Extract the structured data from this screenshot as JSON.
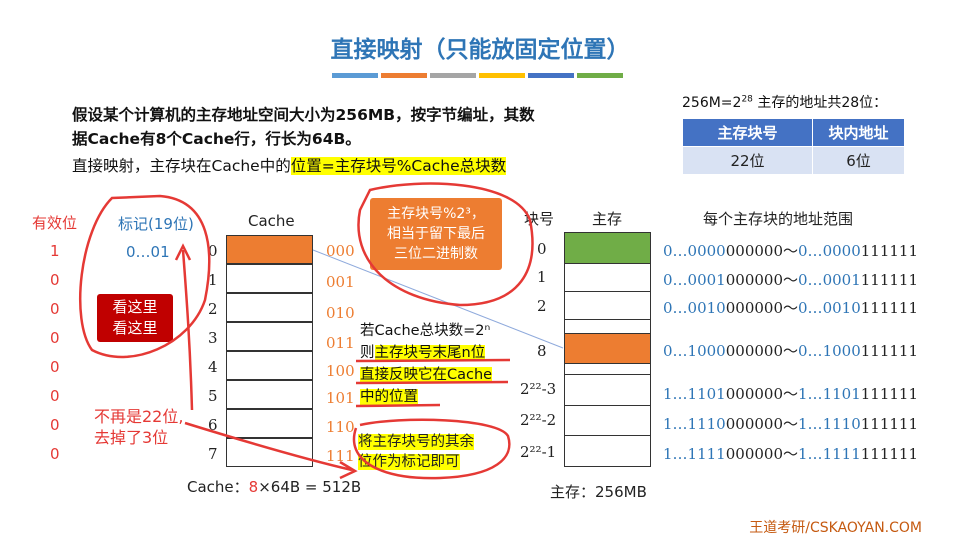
{
  "title": "直接映射（只能放固定位置）",
  "title_bar_colors": [
    "#5b9bd5",
    "#ed7d31",
    "#a5a5a5",
    "#ffc000",
    "#4472c4",
    "#70ad47"
  ],
  "intro": {
    "part1": "假设某个计算机的主存地址空间大小为256MB，按",
    "bold1": "字节",
    "part2": "编址，其数据Cache有8个Cache行，行长为64B。"
  },
  "mapping_rule": {
    "prefix": "直接映射，主存块在Cache中的",
    "highlight": "位置=主存块号%Cache总块数"
  },
  "address": {
    "caption_pre": "256M=2",
    "caption_exp": "28",
    "caption_post": " 主存的地址共28位：",
    "headers": [
      "主存块号",
      "块内地址"
    ],
    "values": [
      "22位",
      "6位"
    ]
  },
  "cache": {
    "valid_header": "有效位",
    "tag_header": "标记(19位)",
    "title": "Cache",
    "valid_bits": [
      "1",
      "0",
      "0",
      "0",
      "0",
      "0",
      "0",
      "0"
    ],
    "tag_first": "0…01",
    "line_numbers": [
      "0",
      "1",
      "2",
      "3",
      "4",
      "5",
      "6",
      "7"
    ],
    "line_binary": [
      "000",
      "001",
      "010",
      "011",
      "100",
      "101",
      "110",
      "111"
    ],
    "filled_index": 0,
    "size_label_pre": "Cache：",
    "size_label_num": "8",
    "size_label_post": "×64B = 512B"
  },
  "callout_orange": [
    "主存块号%2³，",
    "相当于留下最后",
    "三位二进制数"
  ],
  "callout_red": [
    "看这里",
    "看这里"
  ],
  "note_red": [
    "不再是22位,",
    "去掉了3位"
  ],
  "note_middle": {
    "line1": "若Cache总块数=2ⁿ",
    "line2_pre": "则",
    "line2_hl": "主存块号末尾n位",
    "line3": "直接反映它在Cache",
    "line4": "中的位置"
  },
  "note_bottom": [
    "将主存块号的其余",
    "位作为标记即可"
  ],
  "memory": {
    "blockno_header": "块号",
    "title": "主存",
    "range_header": "每个主存块的地址范围",
    "block_numbers": [
      "0",
      "1",
      "2",
      "8",
      "2²²-3",
      "2²²-2",
      "2²²-1"
    ],
    "ranges": [
      {
        "a_pre": "0…",
        "a_hl": "0000",
        "a_tail": "000000",
        "b_pre": "0…",
        "b_hl": "0000",
        "b_tail": "111111"
      },
      {
        "a_pre": "0…",
        "a_hl": "0001",
        "a_tail": "000000",
        "b_pre": "0…",
        "b_hl": "0001",
        "b_tail": "111111"
      },
      {
        "a_pre": "0…",
        "a_hl": "0010",
        "a_tail": "000000",
        "b_pre": "0…",
        "b_hl": "0010",
        "b_tail": "111111"
      },
      {
        "a_pre": "0…",
        "a_hl": "1000",
        "a_tail": "000000",
        "b_pre": "0…",
        "b_hl": "1000",
        "b_tail": "111111"
      },
      {
        "a_pre": "1…",
        "a_hl": "1101",
        "a_tail": "000000",
        "b_pre": "1…",
        "b_hl": "1101",
        "b_tail": "111111"
      },
      {
        "a_pre": "1…",
        "a_hl": "1110",
        "a_tail": "000000",
        "b_pre": "1…",
        "b_hl": "1110",
        "b_tail": "111111"
      },
      {
        "a_pre": "1…",
        "a_hl": "1111",
        "a_tail": "000000",
        "b_pre": "1…",
        "b_hl": "1111",
        "b_tail": "111111"
      }
    ],
    "tilde": "～",
    "size_label": "主存：256MB"
  },
  "colors": {
    "green_block": "#70ad47",
    "orange_block": "#ed7d31",
    "blue_text": "#2e75b6",
    "red_text": "#e53935"
  },
  "footer": "王道考研/CSKAOYAN.COM"
}
